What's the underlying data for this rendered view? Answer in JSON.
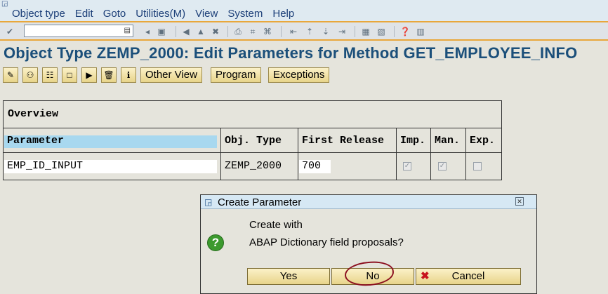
{
  "menubar": {
    "items": [
      "Object type",
      "Edit",
      "Goto",
      "Utilities(M)",
      "View",
      "System",
      "Help"
    ]
  },
  "toolbar": {
    "command_field_value": ""
  },
  "page_title": "Object Type ZEMP_2000: Edit Parameters for Method GET_EMPLOYEE_INFO",
  "app_toolbar": {
    "other_view_label": "Other View",
    "program_label": "Program",
    "exceptions_label": "Exceptions"
  },
  "table": {
    "section_title": "Overview",
    "headers": {
      "parameter": "Parameter",
      "obj_type": "Obj. Type",
      "first_release": "First Release",
      "imp": "Imp.",
      "man": "Man.",
      "exp": "Exp."
    },
    "rows": [
      {
        "parameter": "EMP_ID_INPUT",
        "obj_type": "ZEMP_2000",
        "first_release": "700",
        "imp": true,
        "man": true,
        "exp": false
      }
    ]
  },
  "dialog": {
    "title": "Create Parameter",
    "message_line1": "Create with",
    "message_line2": "ABAP Dictionary field proposals?",
    "yes_label": "Yes",
    "no_label": "No",
    "cancel_label": "Cancel"
  }
}
